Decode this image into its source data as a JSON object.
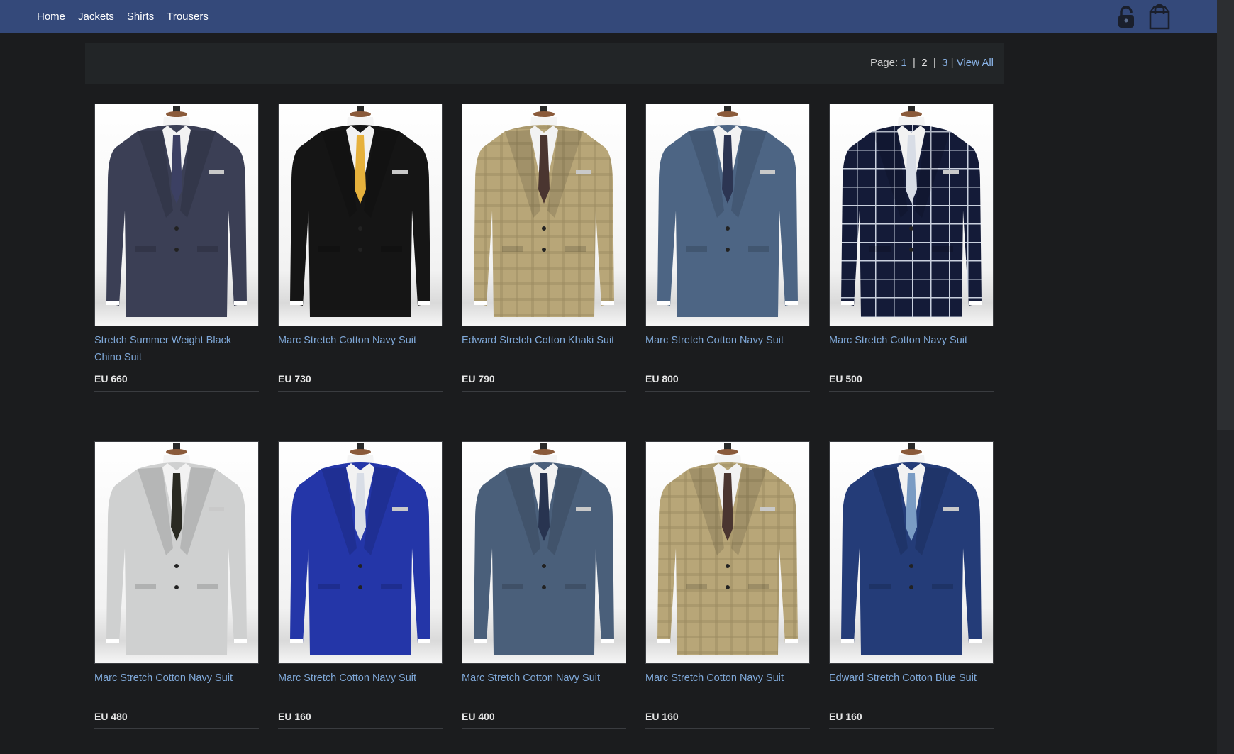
{
  "nav": {
    "items": [
      "Home",
      "Jackets",
      "Shirts",
      "Trousers"
    ]
  },
  "icons": {
    "account": "lock-icon",
    "cart": "shopping-bag-icon"
  },
  "pagination": {
    "label": "Page:",
    "pages": [
      "1",
      "2",
      "3"
    ],
    "current": "2",
    "view_all": "View All"
  },
  "colors": {
    "nav_bg": "#34497a",
    "page_bg": "#1b1c1e",
    "link": "#7fa8d8"
  },
  "products": [
    {
      "title": "Stretch Summer Weight Black Chino Suit",
      "price": "EU 660",
      "color": "#3b3f55",
      "tie": "#3c4063",
      "pattern": "none"
    },
    {
      "title": "Marc Stretch Cotton Navy Suit",
      "price": "EU 730",
      "color": "#151515",
      "tie": "#e6b13c",
      "pattern": "none"
    },
    {
      "title": "Edward Stretch Cotton Khaki Suit",
      "price": "EU 790",
      "color": "#b8a678",
      "tie": "#4a3530",
      "pattern": "check"
    },
    {
      "title": "Marc Stretch Cotton Navy Suit",
      "price": "EU 800",
      "color": "#4d6584",
      "tie": "#2c3552",
      "pattern": "none"
    },
    {
      "title": "Marc Stretch Cotton Navy Suit",
      "price": "EU 500",
      "color": "#141b38",
      "tie": "#d8dde6",
      "pattern": "windowpane"
    },
    {
      "title": "Marc Stretch Cotton Navy Suit",
      "price": "EU 480",
      "color": "#cfd0d0",
      "tie": "#2a2a22",
      "pattern": "none"
    },
    {
      "title": "Marc Stretch Cotton Navy Suit",
      "price": "EU 160",
      "color": "#2436a8",
      "tie": "#d8dde6",
      "pattern": "none"
    },
    {
      "title": "Marc Stretch Cotton Navy Suit",
      "price": "EU 400",
      "color": "#4a5f7a",
      "tie": "#283450",
      "pattern": "none"
    },
    {
      "title": "Marc Stretch Cotton Navy Suit",
      "price": "EU 160",
      "color": "#b8a678",
      "tie": "#4a3530",
      "pattern": "check"
    },
    {
      "title": "Edward Stretch Cotton Blue Suit",
      "price": "EU 160",
      "color": "#243c78",
      "tie": "#7a9cc4",
      "pattern": "none"
    }
  ]
}
